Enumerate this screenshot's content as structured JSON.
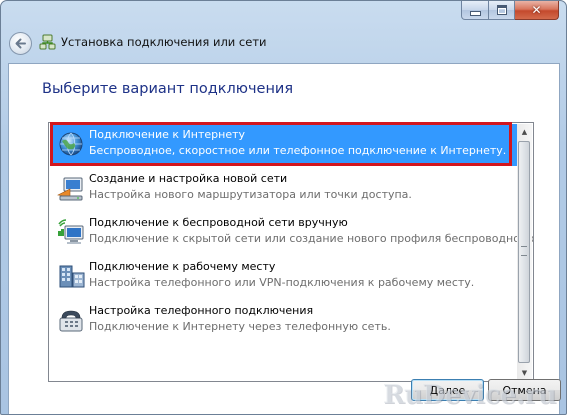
{
  "window": {
    "title": "Установка подключения или сети",
    "close_glyph": "✕"
  },
  "page": {
    "heading": "Выберите вариант подключения"
  },
  "options": [
    {
      "title": "Подключение к Интернету",
      "description": "Беспроводное, скоростное или телефонное подключение к Интернету.",
      "icon": "globe-network-icon",
      "selected": true
    },
    {
      "title": "Создание и настройка новой сети",
      "description": "Настройка нового маршрутизатора или точки доступа.",
      "icon": "router-setup-icon",
      "selected": false
    },
    {
      "title": "Подключение к беспроводной сети вручную",
      "description": "Подключение к скрытой сети или создание нового профиля беспроводной связи.",
      "icon": "wireless-computer-icon",
      "selected": false
    },
    {
      "title": "Подключение к рабочему месту",
      "description": "Настройка телефонного или VPN-подключения к рабочему месту.",
      "icon": "workplace-connection-icon",
      "selected": false
    },
    {
      "title": "Настройка телефонного подключения",
      "description": "Подключение к Интернету через телефонную сеть.",
      "icon": "dialup-modem-icon",
      "selected": false
    }
  ],
  "buttons": {
    "next": "Далее",
    "cancel": "Отмена"
  },
  "watermark": "RuDevice.ru",
  "colors": {
    "selection": "#3399ff",
    "highlight_frame": "#d2161e",
    "heading": "#1e3287"
  }
}
